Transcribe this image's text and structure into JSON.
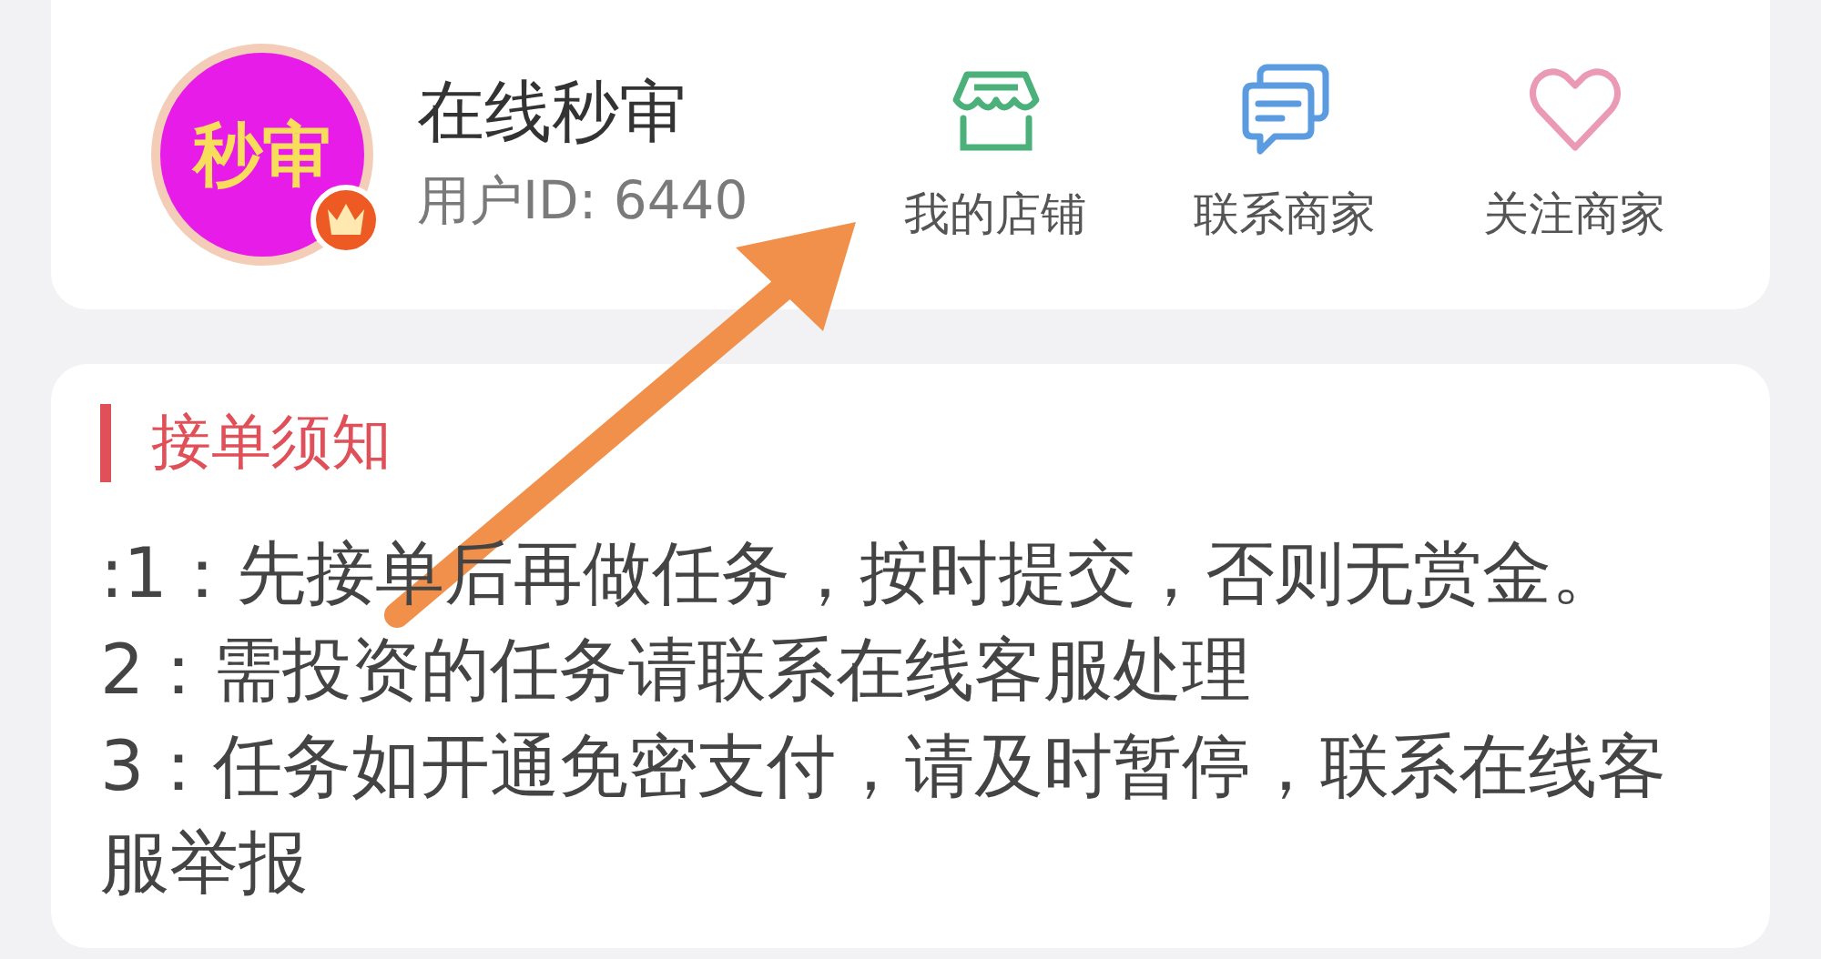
{
  "profile": {
    "avatar_text": "秒审",
    "vip": true,
    "name": "在线秒审",
    "user_id": "用户ID: 6440"
  },
  "actions": [
    {
      "kind": "shop",
      "label": "我的店铺"
    },
    {
      "kind": "chat",
      "label": "联系商家"
    },
    {
      "kind": "heart",
      "label": "关注商家"
    }
  ],
  "notice": {
    "title": "接单须知",
    "lines": [
      ":1：先接单后再做任务，按时提交，否则无赏金。",
      "2：需投资的任务请联系在线客服处理",
      "3：任务如开通免密支付，请及时暂停，联系在线客服举报"
    ]
  }
}
